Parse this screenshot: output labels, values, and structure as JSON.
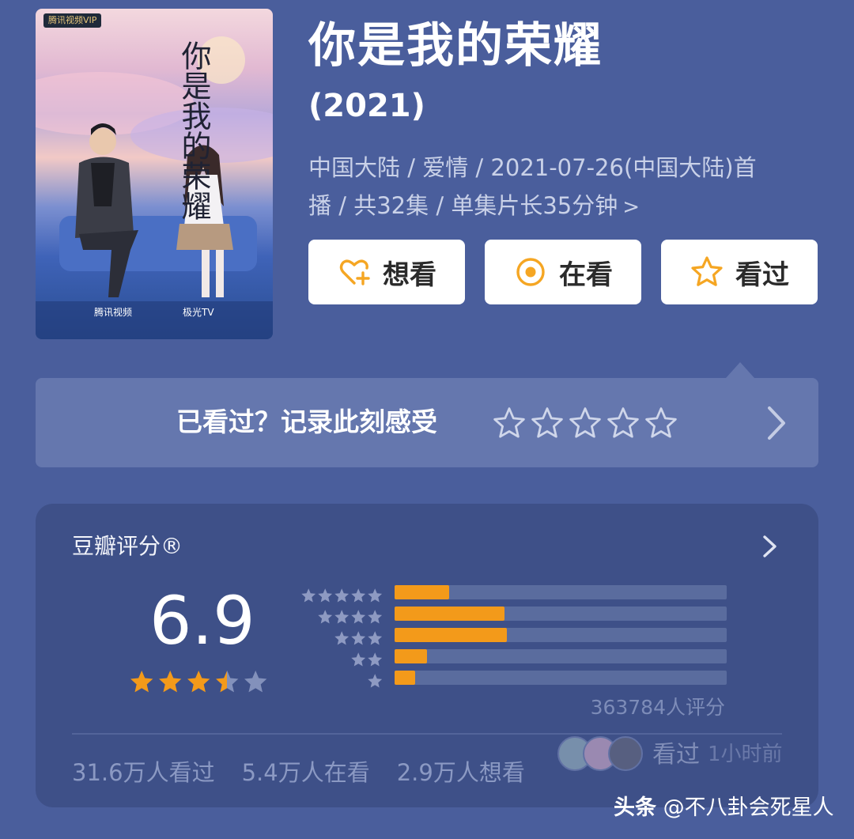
{
  "poster": {
    "badge": "腾讯视频VIP",
    "title": "你是我的荣耀",
    "brand_tencent": "腾讯视频",
    "brand_jiguang": "极光TV"
  },
  "title": "你是我的荣耀",
  "year": "(2021)",
  "meta": {
    "line1": "中国大陆 / 爱情 / 2021-07-26(中国大陆)首",
    "line2": "播 / 共32集 / 单集片长35分钟",
    "chevron": ">"
  },
  "actions": {
    "want_label": "想看",
    "watching_label": "在看",
    "watched_label": "看过",
    "icon_color": "#f5a623"
  },
  "record": {
    "text": "已看过？记录此刻感受",
    "star_count": 5
  },
  "rating": {
    "label": "豆瓣评分®",
    "score": "6.9",
    "score_stars": 3.5,
    "distribution": [
      {
        "stars": 5,
        "percent": 16.5
      },
      {
        "stars": 4,
        "percent": 33.1
      },
      {
        "stars": 3,
        "percent": 33.7
      },
      {
        "stars": 2,
        "percent": 9.8
      },
      {
        "stars": 1,
        "percent": 6.3
      }
    ],
    "votes": "363784人评分",
    "recent_action": "看过",
    "recent_time": "1小时前",
    "counts": {
      "watched": "31.6万人看过",
      "watching": "5.4万人在看",
      "want": "2.9万人想看"
    },
    "accent_color": "#f39a1a"
  },
  "watermark": {
    "source": "头条",
    "author": "@不八卦会死星人"
  }
}
